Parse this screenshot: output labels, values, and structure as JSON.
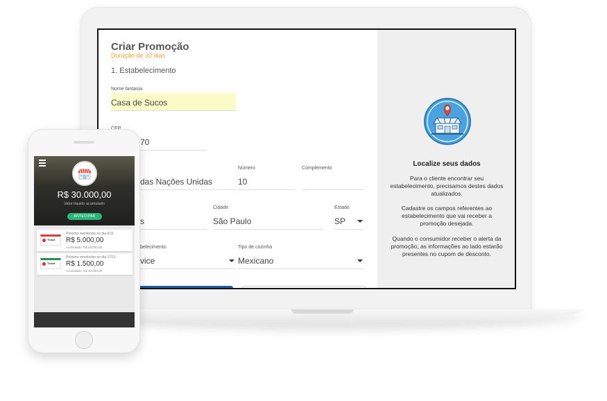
{
  "laptop": {
    "form": {
      "title": "Criar Promoção",
      "subtitle": "Duração de 30 dias",
      "section": "1. Estabelecimento",
      "fields": {
        "nome_fantasia": {
          "label": "Nome fantasia",
          "value": "Casa de Sucos"
        },
        "cep": {
          "label": "CEP",
          "value": "70"
        },
        "endereco": {
          "value": "das Nações Unidas"
        },
        "numero": {
          "label": "Número",
          "value": "10"
        },
        "complemento": {
          "label": "Complemento",
          "value": ""
        },
        "bairro": {
          "value": "s"
        },
        "cidade": {
          "label": "Cidade",
          "value": "São Paulo"
        },
        "estado": {
          "label": "Estado",
          "value": "SP"
        },
        "tipo_estabelecimento": {
          "label": "belecimento",
          "value": "vice"
        },
        "tipo_cozinha": {
          "label": "Tipo de cozinha",
          "value": "Mexicano"
        }
      }
    },
    "info": {
      "title": "Localize seus dados",
      "p1": "Para o cliente encontrar seu estabelecimento, precisamos destes dados atualizados.",
      "p2": "Cadastre os campos referentes ao estabelecimento que vai receber a promoção desejada.",
      "p3": "Quando o consumidor receber o alerta da promoção, as informações ao lado estarão presentes no cupom de desconto."
    },
    "colors": {
      "accent": "#f0a33a",
      "primary": "#1e5fa8",
      "highlight": "#fbfbc8",
      "illustration": "#4aa3df"
    }
  },
  "phone": {
    "balance": "R$ 30.000,00",
    "balance_label": "Valor líquido acumulado",
    "button": "ANTECIPAR",
    "cards": [
      {
        "logo": "Ticket",
        "label": "Próximo reembolso no dia 6/11",
        "value": "R$ 5.000,00",
        "accumulated": "Acumulado: R$ 20.000,00"
      },
      {
        "logo": "Ticket",
        "label": "Próximo reembolso no dia 17/11",
        "value": "R$ 1.500,00",
        "accumulated": "Acumulado: R$ 10.000,00"
      }
    ],
    "colors": {
      "button": "#2ab57d"
    }
  }
}
